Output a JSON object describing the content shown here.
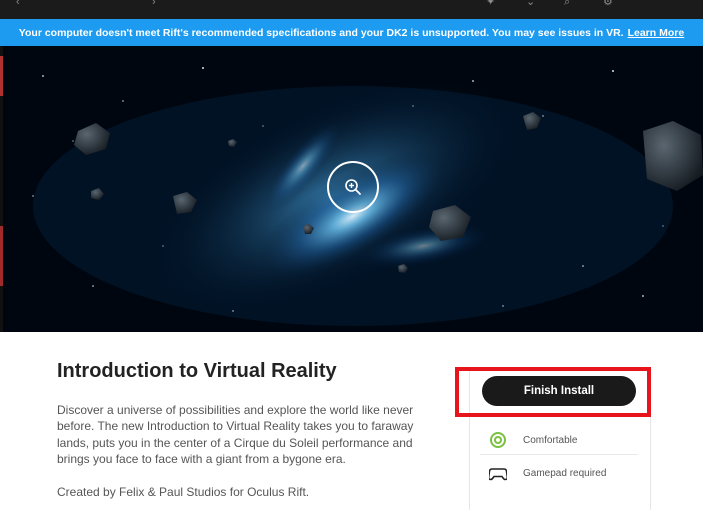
{
  "colors": {
    "banner_bg": "#1c9bf0",
    "button_bg": "#1a1a1a",
    "highlight_border": "#e8141c",
    "comfort_icon": "#7ac142"
  },
  "top_bar": {
    "icons": [
      "back-icon",
      "chevron-icon",
      "star-icon",
      "chevron-down-icon",
      "search-icon",
      "settings-icon"
    ]
  },
  "banner": {
    "message": "Your computer doesn't meet Rift's recommended specifications and your DK2 is unsupported. You may see issues in VR.",
    "link": "Learn More"
  },
  "hero": {
    "zoom_icon": "zoom-in-icon"
  },
  "app": {
    "title": "Introduction to Virtual Reality",
    "description": "Discover a universe of possibilities and explore the world like never before. The new Introduction to Virtual Reality takes you to faraway lands, puts you in the center of a Cirque du Soleil performance and brings you face to face with a giant from a bygone era.",
    "credit": "Created by Felix & Paul Studios for Oculus Rift."
  },
  "sidebar": {
    "action_button": "Finish Install",
    "features": [
      {
        "icon": "comfort-icon",
        "label": "Comfortable"
      },
      {
        "icon": "gamepad-icon",
        "label": "Gamepad required"
      }
    ]
  }
}
